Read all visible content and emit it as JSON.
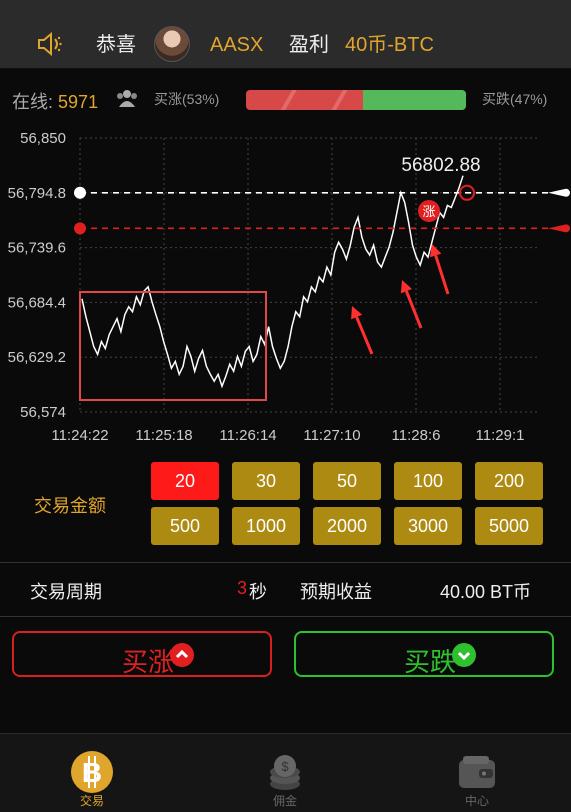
{
  "header": {
    "congrats": "恭喜",
    "username": "AASX",
    "profit_label": "盈利",
    "profit_value": "40币-BTC"
  },
  "market": {
    "online_label": "在线:",
    "online_count": "5971",
    "up_pct_label": "买涨(53%)",
    "down_pct_label": "买跌(47%)",
    "up_ratio": 0.53,
    "down_ratio": 0.47
  },
  "chart_data": {
    "type": "line",
    "current_price_label": "56802.88",
    "current_price": 56794.8,
    "entry_price": 56759.0,
    "entry_marker_label": "涨",
    "y_ticks": [
      "56,850",
      "56,794.8",
      "56,739.6",
      "56,684.4",
      "56,629.2",
      "56,574"
    ],
    "ylim": [
      56574,
      56850
    ],
    "x_ticks": [
      "11:24:22",
      "11:25:18",
      "11:26:14",
      "11:27:10",
      "11:28:6",
      "11:29:1"
    ],
    "grid": true,
    "series": [
      {
        "values": [
          56688,
          56670,
          56655,
          56640,
          56632,
          56645,
          56638,
          56652,
          56660,
          56668,
          56655,
          56672,
          56680,
          56675,
          56690,
          56682,
          56696,
          56700,
          56685,
          56672,
          56660,
          56645,
          56632,
          56618,
          56625,
          56612,
          56620,
          56640,
          56630,
          56615,
          56628,
          56636,
          56620,
          56612,
          56605,
          56612,
          56600,
          56610,
          56622,
          56615,
          56630,
          56620,
          56635,
          56640,
          56625,
          56632,
          56650,
          56642,
          56660,
          56640,
          56628,
          56618,
          56625,
          56640,
          56660,
          56675,
          56670,
          56690,
          56685,
          56700,
          56695,
          56710,
          56705,
          56720,
          56712,
          56735,
          56745,
          56738,
          56728,
          56742,
          56760,
          56770,
          56750,
          56738,
          56732,
          56742,
          56725,
          56720,
          56730,
          56740,
          56755,
          56775,
          56795,
          56785,
          56765,
          56742,
          56730,
          56722,
          56735,
          56730,
          56745,
          56760,
          56775,
          56770,
          56782,
          56780,
          56790,
          56800,
          56812
        ],
        "color": "#ffffff"
      }
    ]
  },
  "amount": {
    "label": "交易金额",
    "options": [
      "20",
      "30",
      "50",
      "100",
      "200",
      "500",
      "1000",
      "2000",
      "3000",
      "5000"
    ],
    "selected": "20"
  },
  "info": {
    "period_label": "交易周期",
    "period_value": "3",
    "period_unit": "秒",
    "expected_label": "预期收益",
    "expected_value": "40.00 BT币"
  },
  "actions": {
    "buy_up": "买涨",
    "buy_down": "买跌"
  },
  "colors": {
    "accent_gold": "#e0a52c",
    "up_red": "#e02020",
    "down_green": "#2ec02e",
    "button_gold": "#ad8a12"
  },
  "nav": {
    "items": [
      {
        "label": "交易",
        "icon": "bitcoin-icon",
        "active": true
      },
      {
        "label": "佣金",
        "icon": "coin-stack-icon",
        "active": false
      },
      {
        "label": "中心",
        "icon": "wallet-icon",
        "active": false
      }
    ]
  }
}
